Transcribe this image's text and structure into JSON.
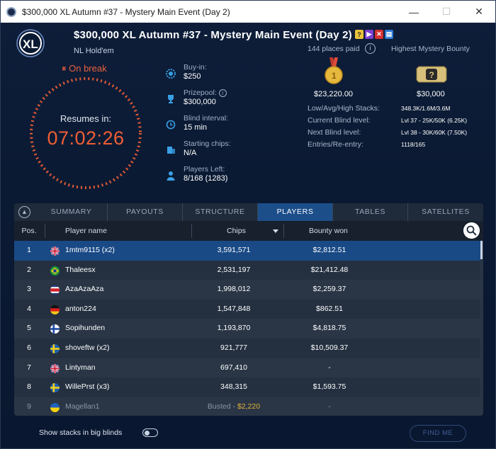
{
  "window": {
    "title": "$300,000 XL Autumn #37 - Mystery Main Event (Day 2)"
  },
  "header": {
    "logo_text": "XL",
    "title": "$300,000 XL Autumn #37 - Mystery Main Event (Day 2)",
    "game_type": "NL Hold'em",
    "badges": [
      {
        "text": "?",
        "color": "#e9c23a"
      },
      {
        "text": "▶",
        "color": "#7a3fd0"
      },
      {
        "text": "✕",
        "color": "#d43030"
      },
      {
        "text": "▤",
        "color": "#2a7bd6"
      }
    ]
  },
  "status": {
    "on_break": "On break",
    "resumes_label": "Resumes in:",
    "countdown": "07:02:26"
  },
  "info": {
    "buyin_label": "Buy-in:",
    "buyin_value": "$250",
    "prizepool_label": "Prizepool:",
    "prizepool_value": "$300,000",
    "blind_interval_label": "Blind interval:",
    "blind_interval_value": "15 min",
    "starting_chips_label": "Starting chips:",
    "starting_chips_value": "N/A",
    "players_left_label": "Players Left:",
    "players_left_value": "8/168 (1283)"
  },
  "prizes": {
    "places_paid": "144 places paid",
    "info_icon_text": "i",
    "highest_bounty_label": "Highest Mystery Bounty",
    "first_prize": "$23,220.00",
    "mystery_box_text": "?",
    "highest_bounty": "$30,000"
  },
  "stats": {
    "stacks_label": "Low/Avg/High Stacks:",
    "stacks_value": "348.3K/1.6M/3.6M",
    "current_blind_label": "Current Blind level:",
    "current_blind_value": "Lvl 37 - 25K/50K (6.25K)",
    "next_blind_label": "Next Blind level:",
    "next_blind_value": "Lvl 38 - 30K/60K (7.50K)",
    "entries_label": "Entries/Re-entry:",
    "entries_value": "1118/165"
  },
  "tabs": [
    "SUMMARY",
    "PAYOUTS",
    "STRUCTURE",
    "PLAYERS",
    "TABLES",
    "SATELLITES"
  ],
  "active_tab": "PLAYERS",
  "table": {
    "headers": {
      "pos": "Pos.",
      "name": "Player name",
      "chips": "Chips",
      "bounty": "Bounty won"
    },
    "rows": [
      {
        "pos": "1",
        "flag": "gb",
        "name": "1mtm9115 (x2)",
        "chips": "3,591,571",
        "bounty": "$2,812.51"
      },
      {
        "pos": "2",
        "flag": "br",
        "name": "Thaleesx",
        "chips": "2,531,197",
        "bounty": "$21,412.48"
      },
      {
        "pos": "3",
        "flag": "cr",
        "name": "AzaAzaAza",
        "chips": "1,998,012",
        "bounty": "$2,259.37"
      },
      {
        "pos": "4",
        "flag": "de",
        "name": "anton224",
        "chips": "1,547,848",
        "bounty": "$862.51"
      },
      {
        "pos": "5",
        "flag": "fi",
        "name": "Sopihunden",
        "chips": "1,193,870",
        "bounty": "$4,818.75"
      },
      {
        "pos": "6",
        "flag": "se",
        "name": "shoveftw (x2)",
        "chips": "921,777",
        "bounty": "$10,509.37"
      },
      {
        "pos": "7",
        "flag": "gb",
        "name": "Lintyman",
        "chips": "697,410",
        "bounty": "-"
      },
      {
        "pos": "8",
        "flag": "se",
        "name": "WillePrst (x3)",
        "chips": "348,315",
        "bounty": "$1,593.75"
      },
      {
        "pos": "9",
        "flag": "ua",
        "name": "Magellan1",
        "chips_prefix": "Busted - ",
        "chips": "$2,220",
        "bounty": "-"
      }
    ]
  },
  "footer": {
    "stacks_toggle_label": "Show stacks in big blinds",
    "find_me": "FIND ME"
  },
  "colors": {
    "accent": "#1c4e8a",
    "break": "#ef5e35",
    "busted_amount": "#e2b23a"
  }
}
